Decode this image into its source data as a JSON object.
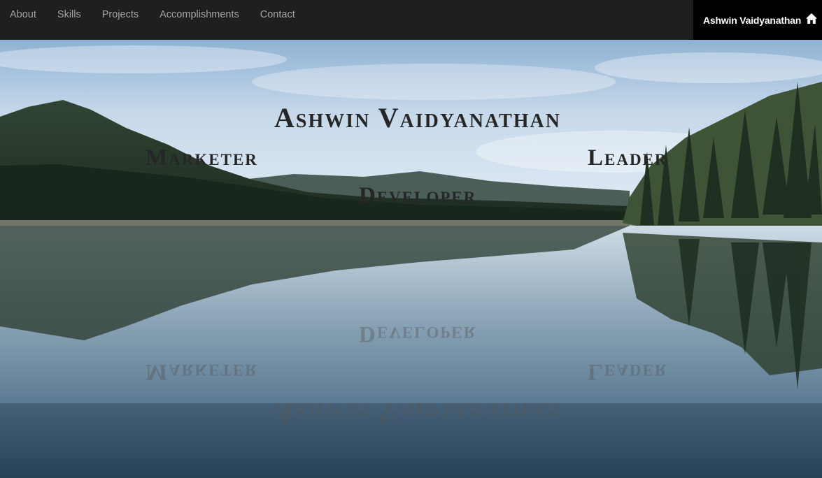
{
  "nav": {
    "links": [
      {
        "label": "About"
      },
      {
        "label": "Skills"
      },
      {
        "label": "Projects"
      },
      {
        "label": "Accomplishments"
      },
      {
        "label": "Contact"
      }
    ],
    "brand": {
      "label": "Ashwin Vaidyanathan",
      "icon": "home-icon"
    }
  },
  "hero": {
    "name": "Ashwin Vaidyanathan",
    "roles": {
      "left": "Marketer",
      "right": "Leader",
      "center": "Developer"
    }
  },
  "colors": {
    "navbar": "#1f1f1f",
    "brand_bg": "#000000",
    "nav_text": "#a3a3a3",
    "heading_text": "#262626"
  }
}
